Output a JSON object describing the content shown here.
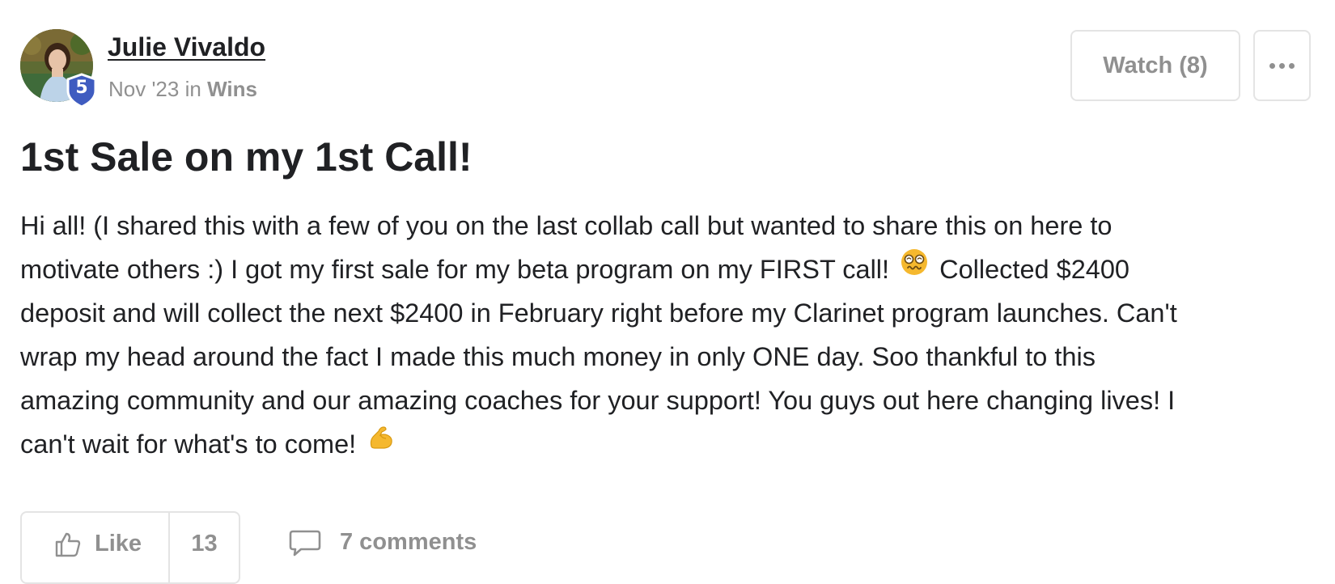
{
  "author": {
    "name": "Julie Vivaldo",
    "level": "5"
  },
  "meta": {
    "date": "Nov '23",
    "connector": "in",
    "category": "Wins"
  },
  "actions": {
    "watch_label": "Watch (8)",
    "more_icon": "ellipsis-icon"
  },
  "post": {
    "title": "1st Sale on my 1st Call!",
    "body_lines": [
      "Hi all! (I shared this with a few of you on the last collab call but wanted to share this on here to",
      "motivate others :) I got my first sale for my beta program on my FIRST call!",
      "Collected $2400",
      "deposit and will collect the next $2400 in February right before my Clarinet program launches. Can't",
      "wrap my head around the fact I made this much money in only ONE day. Soo thankful to this",
      "amazing community and our amazing coaches for your support! You guys out here changing lives! I",
      "can't wait for what's to come!"
    ]
  },
  "footer": {
    "like_label": "Like",
    "like_count": "13",
    "comments_label": "7 comments"
  },
  "colors": {
    "badge": "#3f5cc0",
    "muted_text": "#909090",
    "border": "#e4e4e4",
    "emoji": "#f5b82e"
  }
}
